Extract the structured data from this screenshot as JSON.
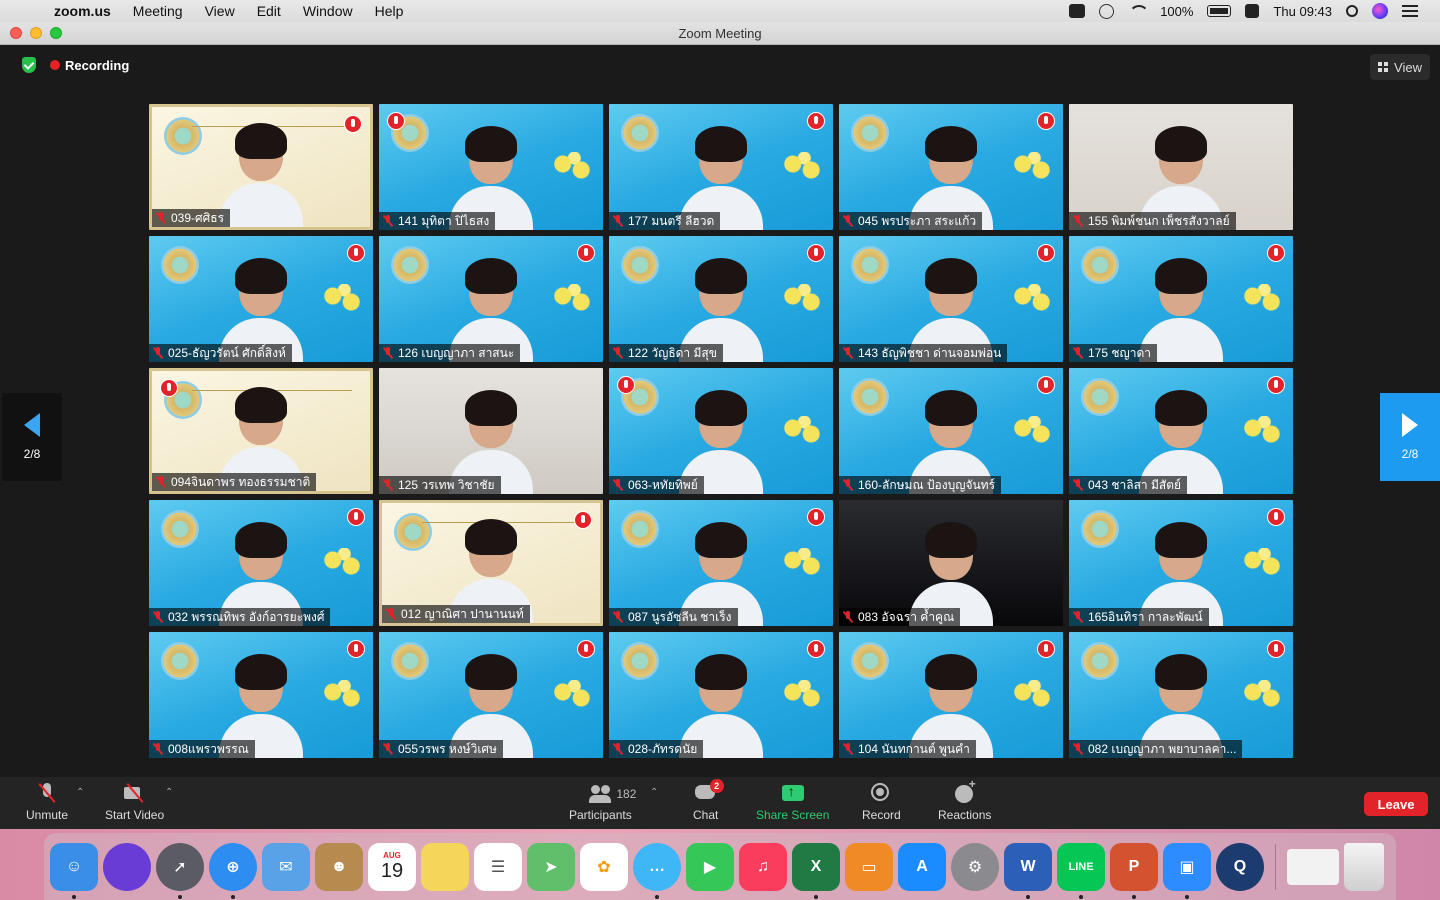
{
  "menubar": {
    "app": "zoom.us",
    "items": [
      "Meeting",
      "View",
      "Edit",
      "Window",
      "Help"
    ],
    "battery": "100%",
    "clock": "Thu 09:43"
  },
  "window": {
    "title": "Zoom Meeting"
  },
  "meeting": {
    "recording_label": "Recording",
    "view_label": "View",
    "page_indicator": "2/8",
    "participants": [
      {
        "name": "039-ศศิธร",
        "bg": "cream"
      },
      {
        "name": "141 มุทิตา ปิไธสง",
        "bg": "blue"
      },
      {
        "name": "177 มนตรี ลีฮวด",
        "bg": "blue"
      },
      {
        "name": "045 พรประภา สระแก้ว",
        "bg": "blue"
      },
      {
        "name": "155 พิมพ์ชนก เพ็ชรสังวาลย์",
        "bg": "plain"
      },
      {
        "name": "025-ธัญวรัตน์ ศักดิ์สิงห์",
        "bg": "blue"
      },
      {
        "name": "126 เบญญาภา สาสนะ",
        "bg": "blue"
      },
      {
        "name": "122 วัญธิดา มีสุข",
        "bg": "blue"
      },
      {
        "name": "143 ธัญพิชชา ด่านจอมพ่อน",
        "bg": "blue"
      },
      {
        "name": "175 ชญาดา",
        "bg": "blue"
      },
      {
        "name": "094จินดาพร ทองธรรมชาติ",
        "bg": "cream"
      },
      {
        "name": "125 วรเทพ วิชาชัย",
        "bg": "room"
      },
      {
        "name": "063-หทัยทิพย์",
        "bg": "blue"
      },
      {
        "name": "160-ลักษมณ ป้องบุญจันทร์",
        "bg": "blue"
      },
      {
        "name": "043 ชาลิสา มีสัตย์",
        "bg": "blue"
      },
      {
        "name": "032 พรรณทิพร อังก์อารยะพงศ์",
        "bg": "blue"
      },
      {
        "name": "012 ญาณิศา ปานานนท์",
        "bg": "cream"
      },
      {
        "name": "087 นูรอัซลีน ชาเร็ง",
        "bg": "blue"
      },
      {
        "name": "083 อัจฉรา ค้ำคูณ",
        "bg": "dark"
      },
      {
        "name": "165อินทิรา กาละพัฒน์",
        "bg": "blue"
      },
      {
        "name": "008แพรวพรรณ",
        "bg": "blue"
      },
      {
        "name": "055วรพร หงษ์วิเศษ",
        "bg": "blue"
      },
      {
        "name": "028-ภัทรดนัย",
        "bg": "blue"
      },
      {
        "name": "104 นันทกานต์ พูนคำ",
        "bg": "blue"
      },
      {
        "name": "082 เบญญาภา พยาบาลคา...",
        "bg": "blue"
      }
    ]
  },
  "toolbar": {
    "unmute": "Unmute",
    "start_video": "Start Video",
    "participants": "Participants",
    "participant_count": "182",
    "chat": "Chat",
    "chat_badge": "2",
    "share_screen": "Share Screen",
    "record": "Record",
    "reactions": "Reactions",
    "leave": "Leave"
  },
  "dock": {
    "calendar_month": "AUG",
    "calendar_day": "19",
    "colors": {
      "finder": "#3a8ee6",
      "siri": "#6a3cd6",
      "launchpad": "#5b5b66",
      "safari": "#2d8df0",
      "mail": "#5aa2e8",
      "contacts": "#b78a4f",
      "calendar": "#ffffff",
      "notes": "#f6d65a",
      "reminders": "#ffffff",
      "maps": "#5fbf6a",
      "photos": "#ffffff",
      "messages": "#3fb6f5",
      "facetime": "#36c759",
      "music": "#fa3d5c",
      "excel": "#1f7a43",
      "books": "#f08a24",
      "appstore": "#1a8cff",
      "prefs": "#8a8a8f",
      "word": "#2b5fb8",
      "line": "#06c755",
      "powerpoint": "#d35230",
      "zoom": "#2d8cff",
      "quicktime": "#1c3b6e"
    }
  }
}
